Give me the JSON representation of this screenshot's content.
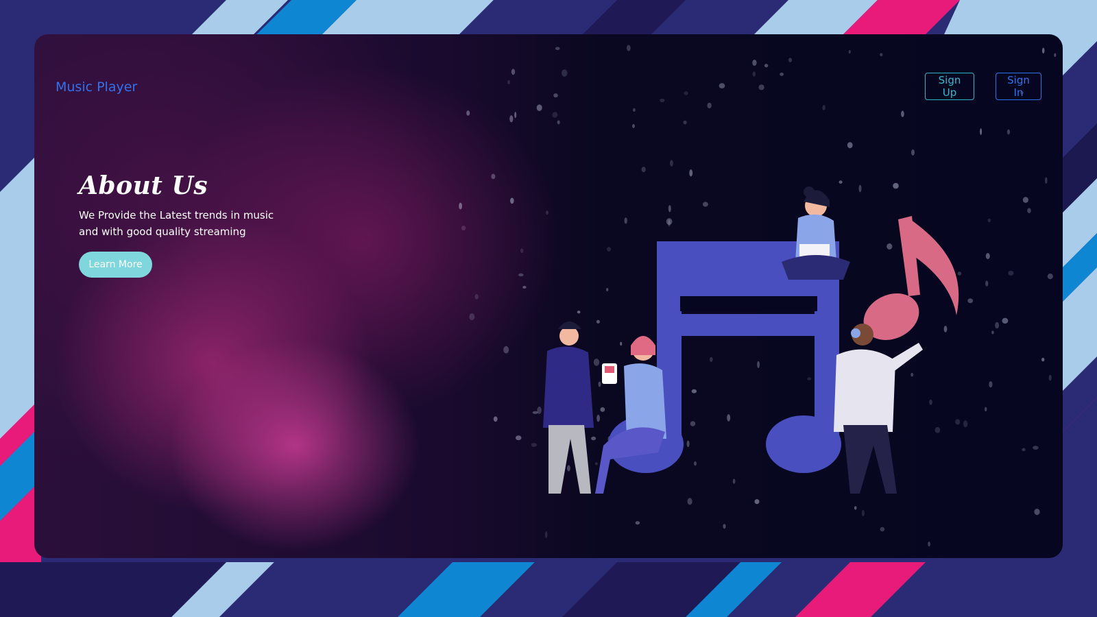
{
  "brand": {
    "title": "Music Player"
  },
  "nav": {
    "signup_label": "Sign Up",
    "signin_label": "Sign In"
  },
  "hero": {
    "title": "About Us",
    "line1": "We Provide the Latest trends in music",
    "line2": "and with good quality streaming",
    "cta_label": "Learn More"
  },
  "colors": {
    "brand_blue": "#2f73f0",
    "signup_teal": "#35b9cf",
    "cta_bg": "#7fd7dd",
    "note_indigo": "#4a4fbf",
    "note_pink": "#d86a86"
  }
}
